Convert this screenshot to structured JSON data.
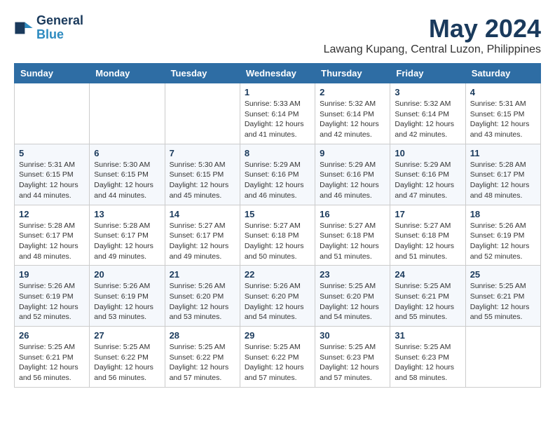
{
  "logo": {
    "line1": "General",
    "line2": "Blue"
  },
  "title": "May 2024",
  "subtitle": "Lawang Kupang, Central Luzon, Philippines",
  "weekdays": [
    "Sunday",
    "Monday",
    "Tuesday",
    "Wednesday",
    "Thursday",
    "Friday",
    "Saturday"
  ],
  "weeks": [
    [
      {
        "day": "",
        "info": ""
      },
      {
        "day": "",
        "info": ""
      },
      {
        "day": "",
        "info": ""
      },
      {
        "day": "1",
        "info": "Sunrise: 5:33 AM\nSunset: 6:14 PM\nDaylight: 12 hours\nand 41 minutes."
      },
      {
        "day": "2",
        "info": "Sunrise: 5:32 AM\nSunset: 6:14 PM\nDaylight: 12 hours\nand 42 minutes."
      },
      {
        "day": "3",
        "info": "Sunrise: 5:32 AM\nSunset: 6:14 PM\nDaylight: 12 hours\nand 42 minutes."
      },
      {
        "day": "4",
        "info": "Sunrise: 5:31 AM\nSunset: 6:15 PM\nDaylight: 12 hours\nand 43 minutes."
      }
    ],
    [
      {
        "day": "5",
        "info": "Sunrise: 5:31 AM\nSunset: 6:15 PM\nDaylight: 12 hours\nand 44 minutes."
      },
      {
        "day": "6",
        "info": "Sunrise: 5:30 AM\nSunset: 6:15 PM\nDaylight: 12 hours\nand 44 minutes."
      },
      {
        "day": "7",
        "info": "Sunrise: 5:30 AM\nSunset: 6:15 PM\nDaylight: 12 hours\nand 45 minutes."
      },
      {
        "day": "8",
        "info": "Sunrise: 5:29 AM\nSunset: 6:16 PM\nDaylight: 12 hours\nand 46 minutes."
      },
      {
        "day": "9",
        "info": "Sunrise: 5:29 AM\nSunset: 6:16 PM\nDaylight: 12 hours\nand 46 minutes."
      },
      {
        "day": "10",
        "info": "Sunrise: 5:29 AM\nSunset: 6:16 PM\nDaylight: 12 hours\nand 47 minutes."
      },
      {
        "day": "11",
        "info": "Sunrise: 5:28 AM\nSunset: 6:17 PM\nDaylight: 12 hours\nand 48 minutes."
      }
    ],
    [
      {
        "day": "12",
        "info": "Sunrise: 5:28 AM\nSunset: 6:17 PM\nDaylight: 12 hours\nand 48 minutes."
      },
      {
        "day": "13",
        "info": "Sunrise: 5:28 AM\nSunset: 6:17 PM\nDaylight: 12 hours\nand 49 minutes."
      },
      {
        "day": "14",
        "info": "Sunrise: 5:27 AM\nSunset: 6:17 PM\nDaylight: 12 hours\nand 49 minutes."
      },
      {
        "day": "15",
        "info": "Sunrise: 5:27 AM\nSunset: 6:18 PM\nDaylight: 12 hours\nand 50 minutes."
      },
      {
        "day": "16",
        "info": "Sunrise: 5:27 AM\nSunset: 6:18 PM\nDaylight: 12 hours\nand 51 minutes."
      },
      {
        "day": "17",
        "info": "Sunrise: 5:27 AM\nSunset: 6:18 PM\nDaylight: 12 hours\nand 51 minutes."
      },
      {
        "day": "18",
        "info": "Sunrise: 5:26 AM\nSunset: 6:19 PM\nDaylight: 12 hours\nand 52 minutes."
      }
    ],
    [
      {
        "day": "19",
        "info": "Sunrise: 5:26 AM\nSunset: 6:19 PM\nDaylight: 12 hours\nand 52 minutes."
      },
      {
        "day": "20",
        "info": "Sunrise: 5:26 AM\nSunset: 6:19 PM\nDaylight: 12 hours\nand 53 minutes."
      },
      {
        "day": "21",
        "info": "Sunrise: 5:26 AM\nSunset: 6:20 PM\nDaylight: 12 hours\nand 53 minutes."
      },
      {
        "day": "22",
        "info": "Sunrise: 5:26 AM\nSunset: 6:20 PM\nDaylight: 12 hours\nand 54 minutes."
      },
      {
        "day": "23",
        "info": "Sunrise: 5:25 AM\nSunset: 6:20 PM\nDaylight: 12 hours\nand 54 minutes."
      },
      {
        "day": "24",
        "info": "Sunrise: 5:25 AM\nSunset: 6:21 PM\nDaylight: 12 hours\nand 55 minutes."
      },
      {
        "day": "25",
        "info": "Sunrise: 5:25 AM\nSunset: 6:21 PM\nDaylight: 12 hours\nand 55 minutes."
      }
    ],
    [
      {
        "day": "26",
        "info": "Sunrise: 5:25 AM\nSunset: 6:21 PM\nDaylight: 12 hours\nand 56 minutes."
      },
      {
        "day": "27",
        "info": "Sunrise: 5:25 AM\nSunset: 6:22 PM\nDaylight: 12 hours\nand 56 minutes."
      },
      {
        "day": "28",
        "info": "Sunrise: 5:25 AM\nSunset: 6:22 PM\nDaylight: 12 hours\nand 57 minutes."
      },
      {
        "day": "29",
        "info": "Sunrise: 5:25 AM\nSunset: 6:22 PM\nDaylight: 12 hours\nand 57 minutes."
      },
      {
        "day": "30",
        "info": "Sunrise: 5:25 AM\nSunset: 6:23 PM\nDaylight: 12 hours\nand 57 minutes."
      },
      {
        "day": "31",
        "info": "Sunrise: 5:25 AM\nSunset: 6:23 PM\nDaylight: 12 hours\nand 58 minutes."
      },
      {
        "day": "",
        "info": ""
      }
    ]
  ]
}
